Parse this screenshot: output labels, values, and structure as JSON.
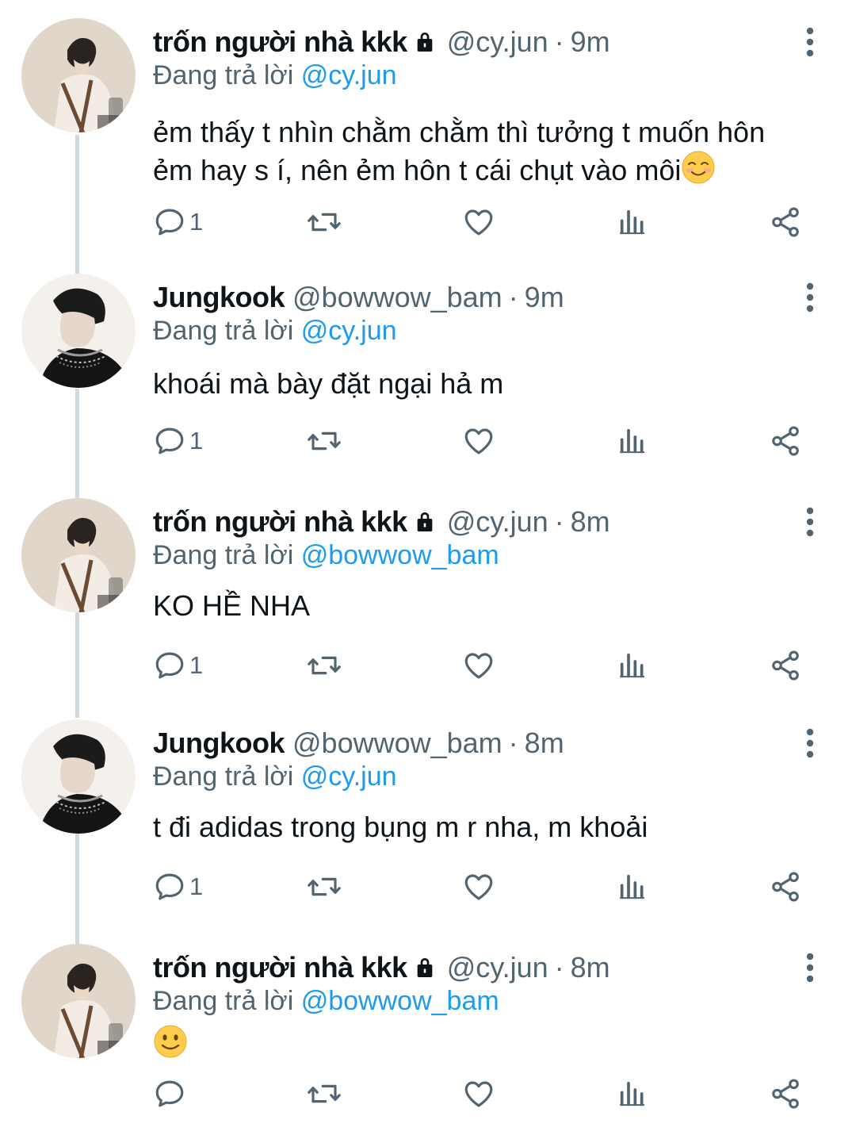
{
  "reply_prefix": "Đang trả lời",
  "colors": {
    "text": "#0f1419",
    "secondary": "#536471",
    "link": "#1d9bf0",
    "thread_line": "#cfd9de"
  },
  "tweets": [
    {
      "name": "trốn người nhà kkk",
      "locked": true,
      "handle": "@cy.jun",
      "time": "9m",
      "reply_to": "@cy.jun",
      "text": "ẻm thấy t nhìn chằm chằm thì tưởng t muốn hôn ẻm hay s í, nên ẻm hôn t cái chụt vào môi",
      "emoji": "smiling-blush-emoji",
      "replies": "1",
      "avatar": "avatar-cy-jun"
    },
    {
      "name": "Jungkook",
      "locked": false,
      "handle": "@bowwow_bam",
      "time": "9m",
      "reply_to": "@cy.jun",
      "text": "khoái mà bày đặt ngại hả m",
      "emoji": "",
      "replies": "1",
      "avatar": "avatar-bowwow-bam"
    },
    {
      "name": "trốn người nhà kkk",
      "locked": true,
      "handle": "@cy.jun",
      "time": "8m",
      "reply_to": "@bowwow_bam",
      "text": "KO HỀ NHA",
      "emoji": "",
      "replies": "1",
      "avatar": "avatar-cy-jun"
    },
    {
      "name": "Jungkook",
      "locked": false,
      "handle": "@bowwow_bam",
      "time": "8m",
      "reply_to": "@cy.jun",
      "text": "t đi adidas trong bụng m r nha, m khoải",
      "emoji": "",
      "replies": "1",
      "avatar": "avatar-bowwow-bam"
    },
    {
      "name": "trốn người nhà kkk",
      "locked": true,
      "handle": "@cy.jun",
      "time": "8m",
      "reply_to": "@bowwow_bam",
      "text": "",
      "emoji": "slightly-smiling-emoji",
      "replies": "",
      "avatar": "avatar-cy-jun"
    }
  ]
}
